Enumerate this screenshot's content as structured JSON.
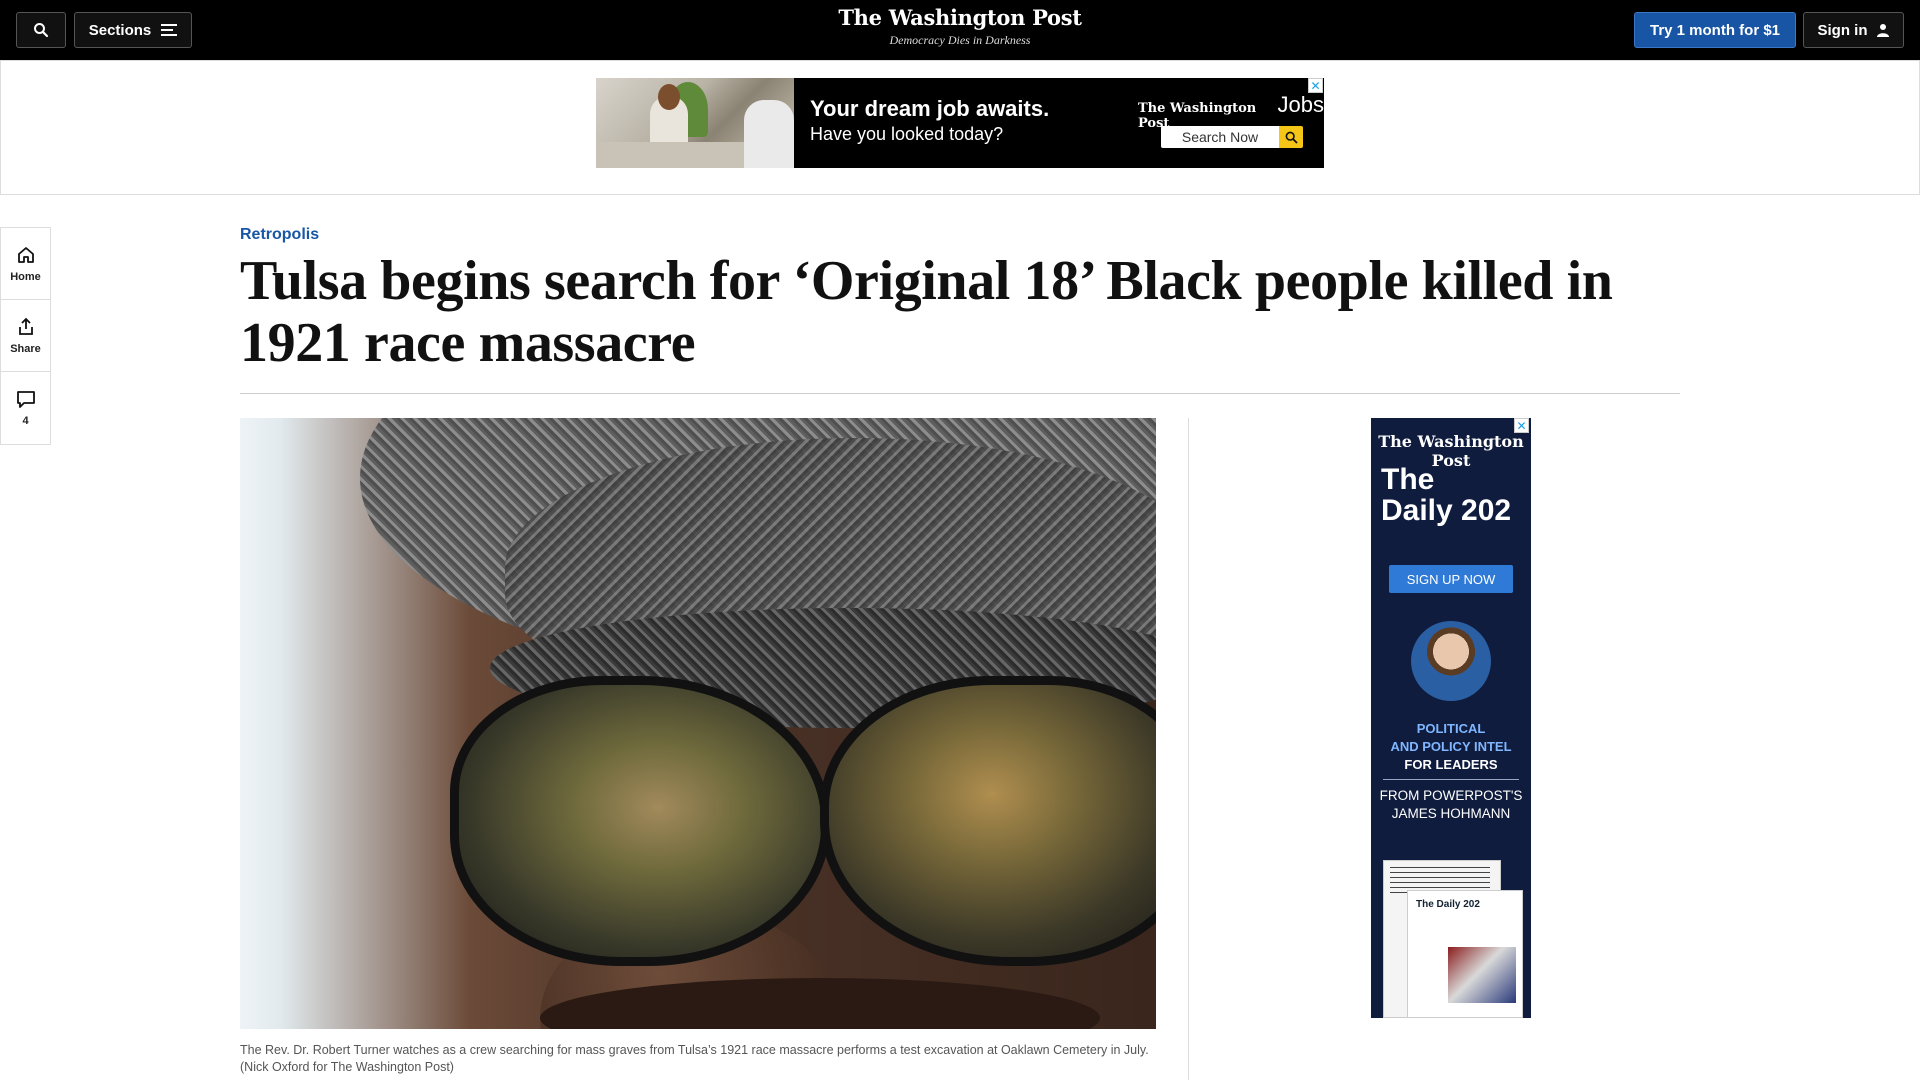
{
  "header": {
    "sections_label": "Sections",
    "logo_title": "The Washington Post",
    "logo_tagline": "Democracy Dies in Darkness",
    "subscribe_label": "Try 1 month for $1",
    "signin_label": "Sign in"
  },
  "top_ad": {
    "headline": "Your dream job awaits.",
    "subhead": "Have you looked today?",
    "brand": "The Washington Post",
    "brand_suffix": "Jobs",
    "search_label": "Search Now",
    "close_glyph": "✕"
  },
  "rail": {
    "items": [
      {
        "label": "Home",
        "icon": "home-icon"
      },
      {
        "label": "Share",
        "icon": "share-icon"
      },
      {
        "label": "4",
        "icon": "comment-icon"
      }
    ]
  },
  "article": {
    "kicker": "Retropolis",
    "headline": "Tulsa begins search for ‘Original 18’ Black people killed in 1921 race massacre",
    "caption": "The Rev. Dr. Robert Turner watches as a crew searching for mass graves from Tulsa’s 1921 race massacre performs a test excavation at Oaklawn Cemetery in July. (Nick Oxford for The Washington Post)"
  },
  "side_ad": {
    "brand": "The Washington Post",
    "title_line1": "The",
    "title_line2": "Daily 202",
    "cta": "SIGN UP NOW",
    "kicker1": "POLITICAL",
    "kicker2": "AND POLICY INTEL",
    "kicker3": "FOR LEADERS",
    "byline1": "FROM POWERPOST'S",
    "byline2": "JAMES HOHMANN",
    "paper_title": "The Daily 202",
    "close_glyph": "✕"
  },
  "colors": {
    "topbar": "#000000",
    "accent_blue": "#1955a5",
    "side_ad_bg": "#0f1c3e",
    "ad_cta": "#2f7ad7",
    "jobs_search_accent": "#f5c518"
  }
}
